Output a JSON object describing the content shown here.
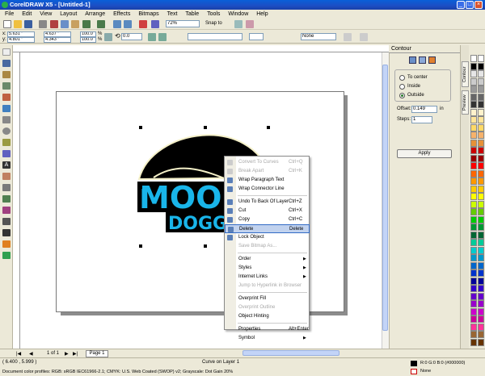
{
  "window": {
    "title": "CorelDRAW X5 - [Untitled-1]",
    "min": "_",
    "max": "□",
    "close": "×"
  },
  "menu": [
    "File",
    "Edit",
    "View",
    "Layout",
    "Arrange",
    "Effects",
    "Bitmaps",
    "Text",
    "Table",
    "Tools",
    "Window",
    "Help"
  ],
  "toolbar": {
    "zoom": "72%",
    "snap_to": "Snap to"
  },
  "propbar": {
    "x": "5.631 \"",
    "y": "4.801 \"",
    "w": "4.637 \"",
    "h": "4.343 \"",
    "scale_x": "100.0",
    "scale_y": "100.0",
    "pct": "%",
    "rotation": "0.0",
    "outline": "None"
  },
  "logo": {
    "line1": "MOON",
    "line2": "DOGGY"
  },
  "context_menu": {
    "items": [
      {
        "label": "Convert To Curves",
        "shortcut": "Ctrl+Q",
        "disabled": true,
        "icon": "convert-curves-icon"
      },
      {
        "label": "Break Apart",
        "shortcut": "Ctrl+K",
        "disabled": true,
        "icon": "break-apart-icon"
      },
      {
        "label": "Wrap Paragraph Text",
        "shortcut": "",
        "disabled": false,
        "icon": "wrap-text-icon"
      },
      {
        "label": "Wrap Connector Line",
        "shortcut": "",
        "disabled": false,
        "icon": "wrap-connector-icon"
      },
      {
        "sep": true
      },
      {
        "label": "Undo To Back Of Layer",
        "shortcut": "Ctrl+Z",
        "disabled": false,
        "icon": "undo-icon"
      },
      {
        "label": "Cut",
        "shortcut": "Ctrl+X",
        "disabled": false,
        "icon": "cut-icon"
      },
      {
        "label": "Copy",
        "shortcut": "Ctrl+C",
        "disabled": false,
        "icon": "copy-icon"
      },
      {
        "label": "Delete",
        "shortcut": "Delete",
        "disabled": false,
        "highlight": true,
        "icon": "delete-icon"
      },
      {
        "label": "Lock Object",
        "shortcut": "",
        "disabled": false,
        "icon": "lock-icon"
      },
      {
        "label": "Save Bitmap As...",
        "shortcut": "",
        "disabled": true,
        "icon": ""
      },
      {
        "sep": true
      },
      {
        "label": "Order",
        "shortcut": "",
        "disabled": false,
        "arrow": true
      },
      {
        "label": "Styles",
        "shortcut": "",
        "disabled": false,
        "arrow": true
      },
      {
        "label": "Internet Links",
        "shortcut": "",
        "disabled": false,
        "arrow": true
      },
      {
        "label": "Jump to Hyperlink in Browser",
        "shortcut": "",
        "disabled": true
      },
      {
        "sep": true
      },
      {
        "label": "Overprint Fill",
        "shortcut": "",
        "disabled": false
      },
      {
        "label": "Overprint Outline",
        "shortcut": "",
        "disabled": true
      },
      {
        "label": "Object Hinting",
        "shortcut": "",
        "disabled": false
      },
      {
        "sep": true
      },
      {
        "label": "Properties",
        "shortcut": "Alt+Enter",
        "disabled": false
      },
      {
        "label": "Symbol",
        "shortcut": "",
        "disabled": false,
        "arrow": true
      }
    ]
  },
  "docker": {
    "title": "Contour",
    "options": [
      "To center",
      "Inside",
      "Outside"
    ],
    "selected": "Outside",
    "offset_label": "Offset:",
    "offset_value": "0.149",
    "offset_unit": "in",
    "steps_label": "Steps:",
    "steps_value": "1",
    "apply": "Apply",
    "tabs": [
      "Contour",
      "Preview"
    ]
  },
  "bottom": {
    "page_info": "1 of 1",
    "page_tab": "Page 1"
  },
  "status": {
    "coords": "( 6.400 , 5.999 )",
    "object": "Curve on Layer 1",
    "profiles": "Document color profiles: RGB: sRGB IEC61966-2.1; CMYK: U.S. Web Coated (SWOP) v2; Grayscale: Dot Gain 20%",
    "fill": "R:0 G:0 B:0 (#000000)",
    "outline": "None"
  },
  "colors": {
    "accent_logo": "#19b5ea",
    "title_blue": "#0a5fd8"
  }
}
